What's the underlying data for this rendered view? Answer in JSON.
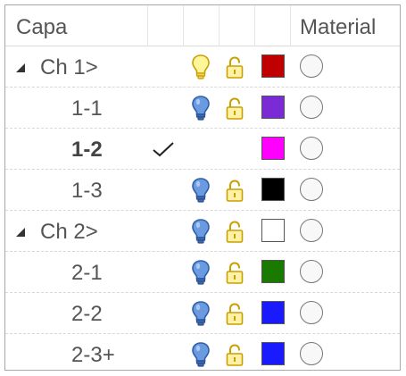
{
  "header": {
    "layer_label": "Capa",
    "material_label": "Material"
  },
  "icons": {
    "expand": "expanded-triangle-icon",
    "current": "checkmark-icon",
    "visible_on": "lightbulb-on-icon",
    "visible": "lightbulb-icon",
    "unlocked": "unlocked-padlock-icon",
    "material": "material-circle-icon"
  },
  "layers": [
    {
      "name": "Ch 1>",
      "expanded": true,
      "current": false,
      "bulb_state": "on",
      "locked": false,
      "color": "#c00000"
    },
    {
      "name": "1-1",
      "expanded": false,
      "current": false,
      "bulb_state": "visible",
      "locked": false,
      "color": "#7b2bd6"
    },
    {
      "name": "1-2",
      "expanded": false,
      "current": true,
      "bulb_state": "none",
      "locked": false,
      "color": "#ff00ff"
    },
    {
      "name": "1-3",
      "expanded": false,
      "current": false,
      "bulb_state": "visible",
      "locked": false,
      "color": "#000000"
    },
    {
      "name": "Ch 2>",
      "expanded": true,
      "current": false,
      "bulb_state": "visible",
      "locked": false,
      "color": "#ffffff"
    },
    {
      "name": "2-1",
      "expanded": false,
      "current": false,
      "bulb_state": "visible",
      "locked": false,
      "color": "#1a7a00"
    },
    {
      "name": "2-2",
      "expanded": false,
      "current": false,
      "bulb_state": "visible",
      "locked": false,
      "color": "#1a1aff"
    },
    {
      "name": "2-3+",
      "expanded": false,
      "current": false,
      "bulb_state": "visible",
      "locked": false,
      "color": "#1a1aff"
    }
  ]
}
